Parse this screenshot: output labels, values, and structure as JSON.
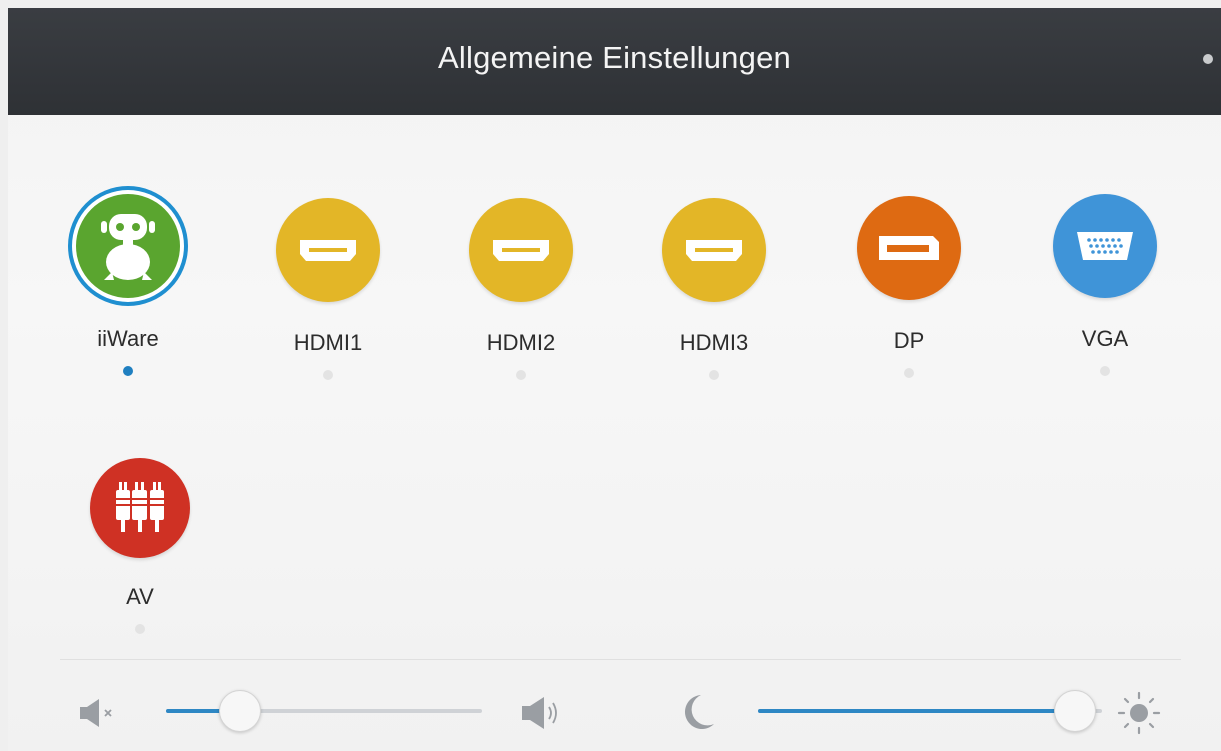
{
  "header": {
    "title": "Allgemeine Einstellungen"
  },
  "sources": [
    {
      "label": "iiWare",
      "icon": "robot-icon",
      "color": "#5aa52f",
      "selected": true
    },
    {
      "label": "HDMI1",
      "icon": "hdmi-port-icon",
      "color": "#e3b627",
      "selected": false
    },
    {
      "label": "HDMI2",
      "icon": "hdmi-port-icon",
      "color": "#e3b627",
      "selected": false
    },
    {
      "label": "HDMI3",
      "icon": "hdmi-port-icon",
      "color": "#e3b627",
      "selected": false
    },
    {
      "label": "DP",
      "icon": "displayport-icon",
      "color": "#de6a12",
      "selected": false
    },
    {
      "label": "VGA",
      "icon": "vga-port-icon",
      "color": "#3f94d8",
      "selected": false
    },
    {
      "label": "AV",
      "icon": "rca-plugs-icon",
      "color": "#cf3124",
      "selected": false
    }
  ],
  "controls": {
    "volume": {
      "level": 0.23,
      "min_icon": "speaker-mute-icon",
      "max_icon": "speaker-loud-icon"
    },
    "brightness": {
      "level": 0.92,
      "min_icon": "moon-icon",
      "max_icon": "sun-icon"
    }
  },
  "colors": {
    "accent": "#2e87c4",
    "header_bg": "#2f3236"
  }
}
